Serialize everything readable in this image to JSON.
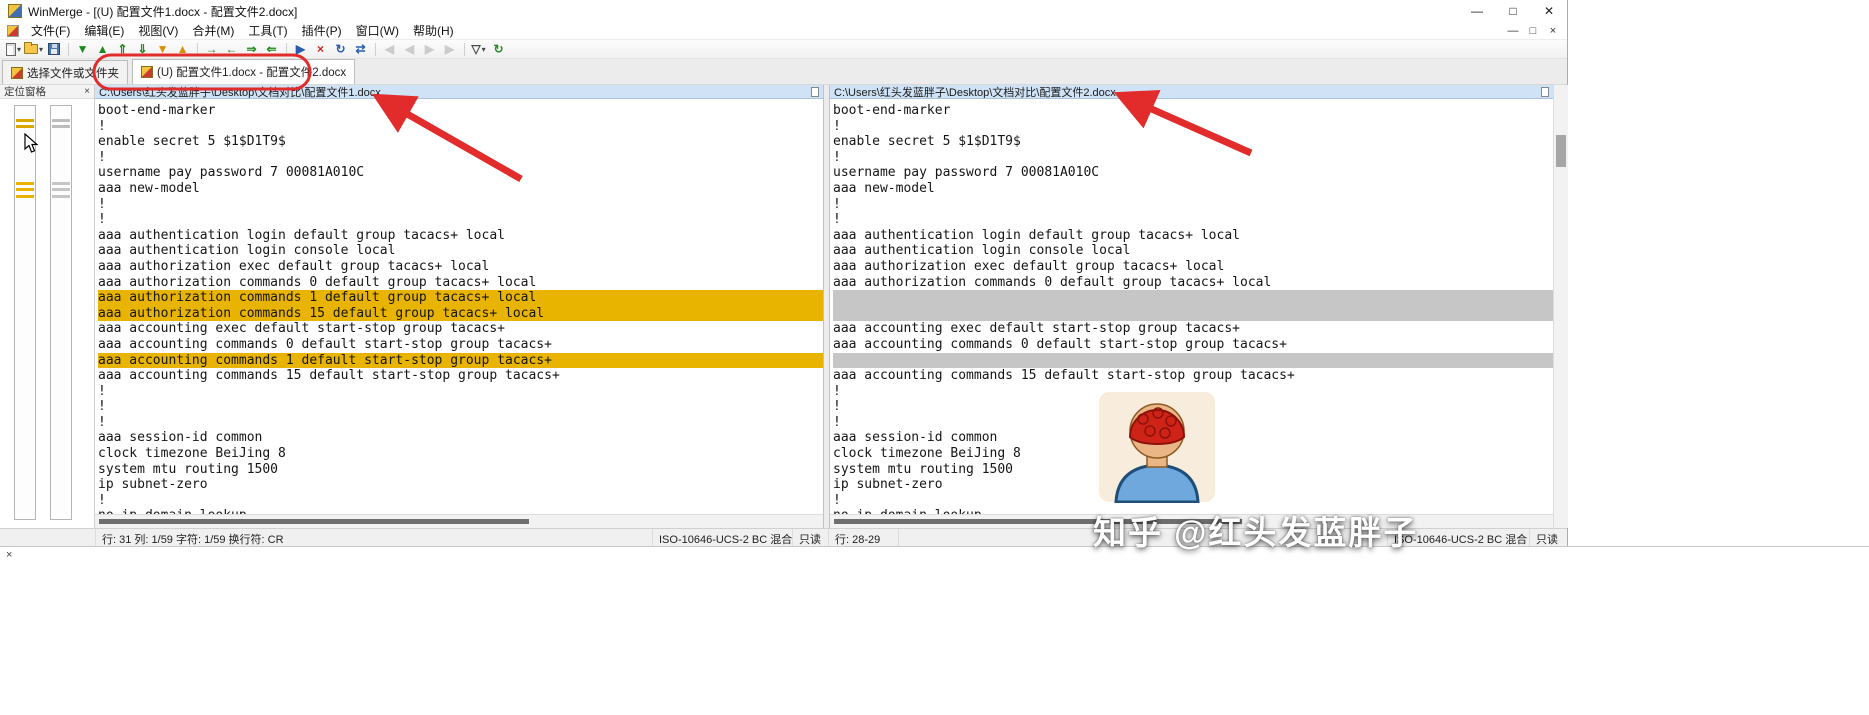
{
  "window": {
    "title": "WinMerge - [(U) 配置文件1.docx - 配置文件2.docx]",
    "controls": {
      "minimize": "—",
      "maximize": "□",
      "close": "✕"
    },
    "mdi_controls": {
      "minimize": "—",
      "restore": "□",
      "close": "×"
    }
  },
  "menu": {
    "items": [
      "文件(F)",
      "编辑(E)",
      "视图(V)",
      "合并(M)",
      "工具(T)",
      "插件(P)",
      "窗口(W)",
      "帮助(H)"
    ]
  },
  "toolbar": {
    "icons": [
      {
        "kind": "page",
        "name": "new-document-button",
        "caret": true
      },
      {
        "kind": "folder",
        "name": "open-button",
        "caret": true
      },
      {
        "kind": "floppy",
        "name": "save-button"
      },
      {
        "kind": "sep"
      },
      {
        "kind": "glyph",
        "name": "next-difference-button",
        "glyph": "▼",
        "color": "#1d8a1d"
      },
      {
        "kind": "glyph",
        "name": "previous-difference-button",
        "glyph": "▲",
        "color": "#1d8a1d"
      },
      {
        "kind": "glyph",
        "name": "first-difference-button",
        "glyph": "⇑",
        "color": "#1d8a1d"
      },
      {
        "kind": "glyph",
        "name": "last-difference-button",
        "glyph": "⇓",
        "color": "#1d8a1d"
      },
      {
        "kind": "glyph",
        "name": "next-conflict-button",
        "glyph": "▼",
        "color": "#d89000"
      },
      {
        "kind": "glyph",
        "name": "previous-conflict-button",
        "glyph": "▲",
        "color": "#d89000"
      },
      {
        "kind": "sep"
      },
      {
        "kind": "glyph",
        "name": "copy-to-right-button",
        "glyph": "→",
        "color": "#1d8a1d"
      },
      {
        "kind": "glyph",
        "name": "copy-to-left-button",
        "glyph": "←",
        "color": "#1d8a1d"
      },
      {
        "kind": "glyph",
        "name": "copy-all-right-button",
        "glyph": "⇒",
        "color": "#1d8a1d"
      },
      {
        "kind": "glyph",
        "name": "copy-all-left-button",
        "glyph": "⇐",
        "color": "#1d8a1d"
      },
      {
        "kind": "sep"
      },
      {
        "kind": "glyph",
        "name": "auto-merge-button",
        "glyph": "▶",
        "color": "#2a5db0"
      },
      {
        "kind": "glyph",
        "name": "delete-button",
        "glyph": "×",
        "color": "#cc2222"
      },
      {
        "kind": "glyph",
        "name": "refresh-button",
        "glyph": "↻",
        "color": "#2a5db0"
      },
      {
        "kind": "glyph",
        "name": "swap-panes-button",
        "glyph": "⇄",
        "color": "#2a5db0"
      },
      {
        "kind": "sep"
      },
      {
        "kind": "glyph",
        "name": "previous-file-button",
        "glyph": "◀",
        "color": "#aaaaaa",
        "disabled": true
      },
      {
        "kind": "glyph",
        "name": "previous-page-button",
        "glyph": "◀",
        "color": "#aaaaaa",
        "disabled": true
      },
      {
        "kind": "glyph",
        "name": "next-page-button",
        "glyph": "▶",
        "color": "#aaaaaa",
        "disabled": true
      },
      {
        "kind": "glyph",
        "name": "next-file-button",
        "glyph": "▶",
        "color": "#aaaaaa",
        "disabled": true
      },
      {
        "kind": "sep"
      },
      {
        "kind": "glyph",
        "name": "filter-button",
        "glyph": "▽",
        "color": "#4a4a4a",
        "caret": true
      },
      {
        "kind": "glyph",
        "name": "recompare-button",
        "glyph": "↻",
        "color": "#2a8a2a"
      }
    ]
  },
  "tabs": [
    {
      "label": "选择文件或文件夹"
    },
    {
      "label": "(U) 配置文件1.docx - 配置文件2.docx",
      "active": true
    }
  ],
  "location_pane": {
    "title": "定位窗格",
    "close_glyph": "×"
  },
  "left_pane": {
    "path": "C:\\Users\\红头发蓝胖子\\Desktop\\文档对比\\配置文件1.docx",
    "lines": [
      {
        "t": "boot-end-marker"
      },
      {
        "t": "!"
      },
      {
        "t": "enable secret 5 $1$D1T9$"
      },
      {
        "t": "!"
      },
      {
        "t": "username pay password 7 00081A010C"
      },
      {
        "t": "aaa new-model"
      },
      {
        "t": "!"
      },
      {
        "t": "!"
      },
      {
        "t": "aaa authentication login default group tacacs+ local"
      },
      {
        "t": "aaa authentication login console local"
      },
      {
        "t": "aaa authorization exec default group tacacs+ local"
      },
      {
        "t": "aaa authorization commands 0 default group tacacs+ local"
      },
      {
        "t": "aaa authorization commands 1 default group tacacs+ local",
        "h": "diff"
      },
      {
        "t": "aaa authorization commands 15 default group tacacs+ local",
        "h": "diff"
      },
      {
        "t": "aaa accounting exec default start-stop group tacacs+"
      },
      {
        "t": "aaa accounting commands 0 default start-stop group tacacs+"
      },
      {
        "t": "aaa accounting commands 1 default start-stop group tacacs+",
        "h": "diff"
      },
      {
        "t": "aaa accounting commands 15 default start-stop group tacacs+"
      },
      {
        "t": "!"
      },
      {
        "t": "!"
      },
      {
        "t": "!"
      },
      {
        "t": "aaa session-id common"
      },
      {
        "t": "clock timezone BeiJing 8"
      },
      {
        "t": "system mtu routing 1500"
      },
      {
        "t": "ip subnet-zero"
      },
      {
        "t": "!"
      },
      {
        "t": "no ip domain lookup"
      }
    ]
  },
  "right_pane": {
    "path": "C:\\Users\\红头发蓝胖子\\Desktop\\文档对比\\配置文件2.docx",
    "embedded_image_alt": "cartoon avatar - back of head with red curly hair and blue shirt",
    "lines": [
      {
        "t": "boot-end-marker"
      },
      {
        "t": "!"
      },
      {
        "t": "enable secret 5 $1$D1T9$"
      },
      {
        "t": "!"
      },
      {
        "t": "username pay password 7 00081A010C"
      },
      {
        "t": "aaa new-model"
      },
      {
        "t": "!"
      },
      {
        "t": "!"
      },
      {
        "t": "aaa authentication login default group tacacs+ local"
      },
      {
        "t": "aaa authentication login console local"
      },
      {
        "t": "aaa authorization exec default group tacacs+ local"
      },
      {
        "t": "aaa authorization commands 0 default group tacacs+ local"
      },
      {
        "t": "",
        "h": "gap"
      },
      {
        "t": "",
        "h": "gap"
      },
      {
        "t": "aaa accounting exec default start-stop group tacacs+"
      },
      {
        "t": "aaa accounting commands 0 default start-stop group tacacs+"
      },
      {
        "t": "",
        "h": "gap"
      },
      {
        "t": "aaa accounting commands 15 default start-stop group tacacs+"
      },
      {
        "t": "!"
      },
      {
        "t": "!"
      },
      {
        "t": "!"
      },
      {
        "t": "aaa session-id common"
      },
      {
        "t": "clock timezone BeiJing 8"
      },
      {
        "t": "system mtu routing 1500"
      },
      {
        "t": "ip subnet-zero"
      },
      {
        "t": "!"
      },
      {
        "t": "no ip domain lookup"
      }
    ]
  },
  "status_bar": {
    "left_position": "行: 31 列: 1/59 字符: 1/59 换行符: CR",
    "left_encoding": "ISO-10646-UCS-2 BC 混合",
    "left_readonly": "只读",
    "right_position": "行: 28-29",
    "right_encoding": "ISO-10646-UCS-2 BC 混合",
    "right_readonly": "只读"
  },
  "watermark": {
    "text": "知乎 @红头发蓝胖子"
  },
  "bottom_panel": {
    "close_glyph": "×"
  }
}
